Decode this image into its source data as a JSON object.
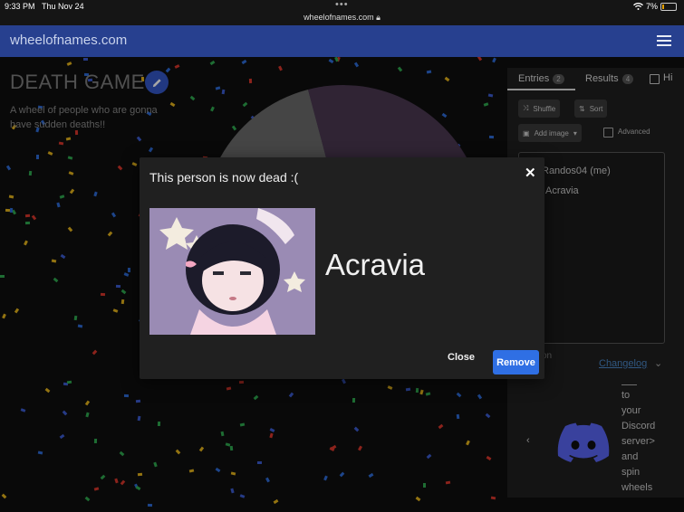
{
  "status_bar": {
    "time": "9:33 PM",
    "date": "Thu Nov 24",
    "url": "wheelofnames.com",
    "battery": "7%"
  },
  "navbar": {
    "brand": "wheelofnames.com",
    "menu_icon": "hamburger-menu-icon"
  },
  "wheel_info": {
    "title": "DEATH GAME",
    "description": "A wheel of people who are gonna have sudden deaths!!"
  },
  "side_panel": {
    "tabs": [
      {
        "label": "Entries",
        "count": "2"
      },
      {
        "label": "Results",
        "count": "4"
      }
    ],
    "hide_label": "Hi",
    "buttons": {
      "shuffle": "Shuffle",
      "sort": "Sort",
      "add_image": "Add image"
    },
    "advanced_label": "Advanced",
    "entries": [
      "Randos04 (me)",
      "Acravia"
    ],
    "text_fragment": "on",
    "changelog": "Changelog",
    "promo_text": [
      "to",
      "your",
      "Discord",
      "server>",
      "and",
      "spin",
      "wheels"
    ]
  },
  "dialog": {
    "title": "This person is now dead :(",
    "winner": "Acravia",
    "close_label": "Close",
    "remove_label": "Remove"
  },
  "colors": {
    "navbar": "#27408f",
    "accent": "#3356c7",
    "remove_button": "#2f6fe4",
    "discord": "#5865f2"
  }
}
